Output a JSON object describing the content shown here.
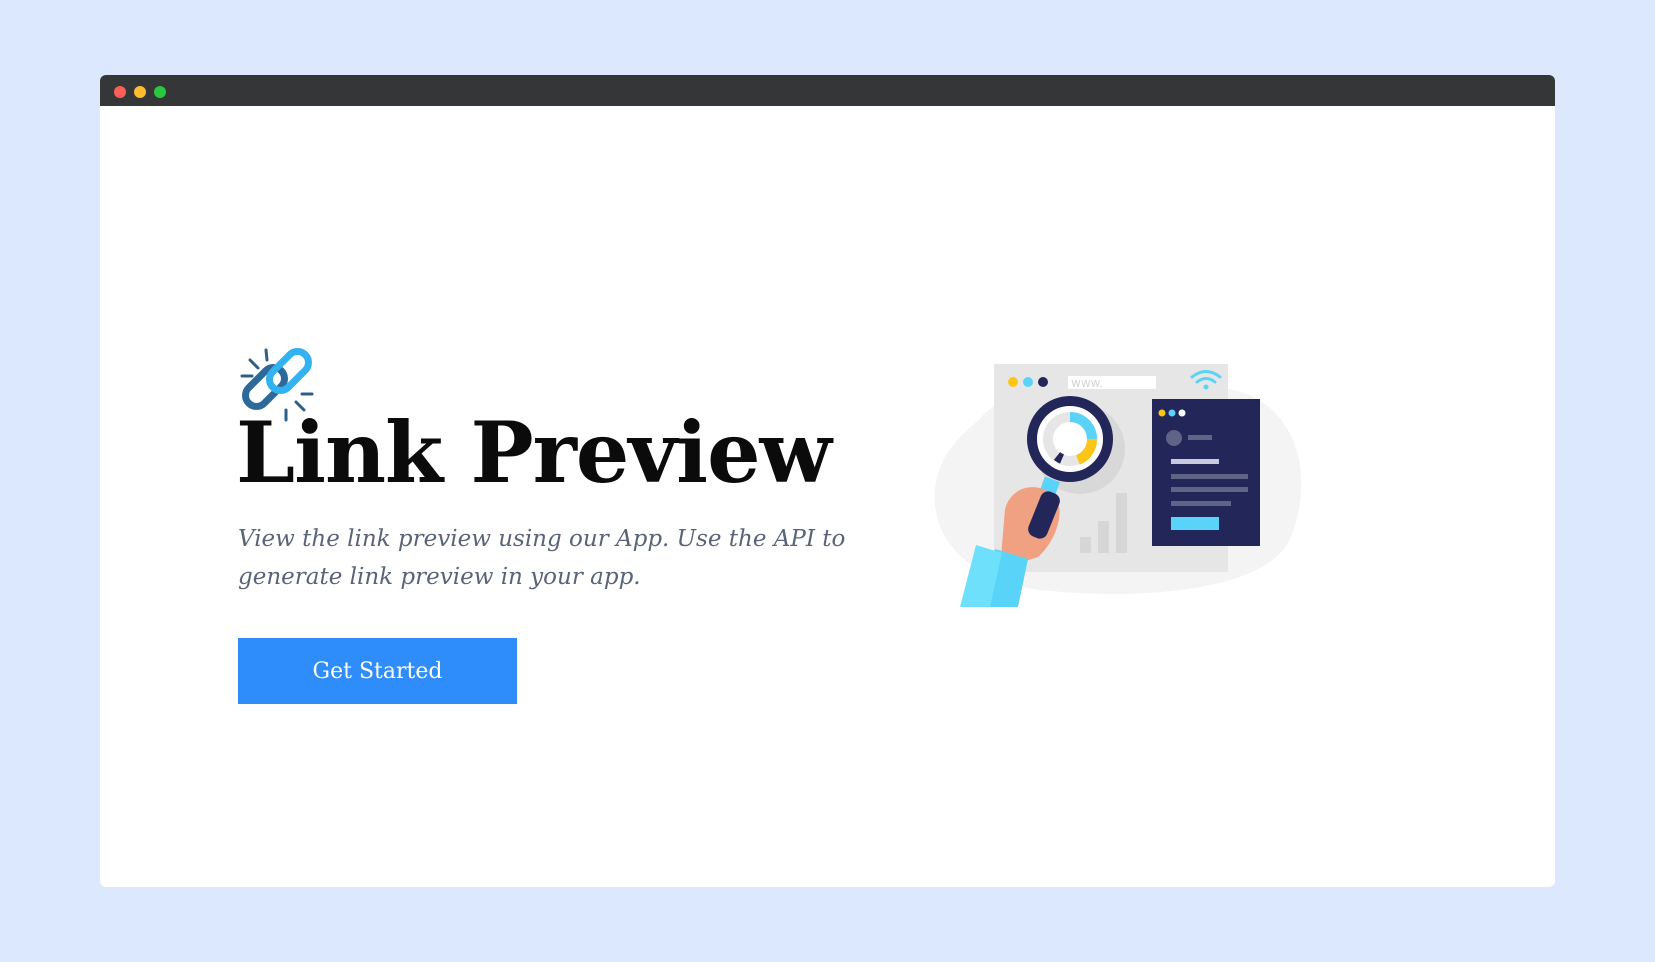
{
  "window": {
    "controls": [
      "close",
      "minimize",
      "maximize"
    ]
  },
  "hero": {
    "logo_icon": "chain-link-icon",
    "title": "Link Preview",
    "description": "View the link preview using our App. Use the API to generate link preview in your app.",
    "cta_label": "Get Started"
  },
  "illustration": {
    "icon": "magnifier-webpage-illustration",
    "url_text": "www."
  },
  "colors": {
    "background": "#dbe8fd",
    "titlebar": "#353638",
    "primary_button": "#2f8cfb",
    "title_text": "#0b0b0b",
    "body_text": "#5a6478"
  }
}
